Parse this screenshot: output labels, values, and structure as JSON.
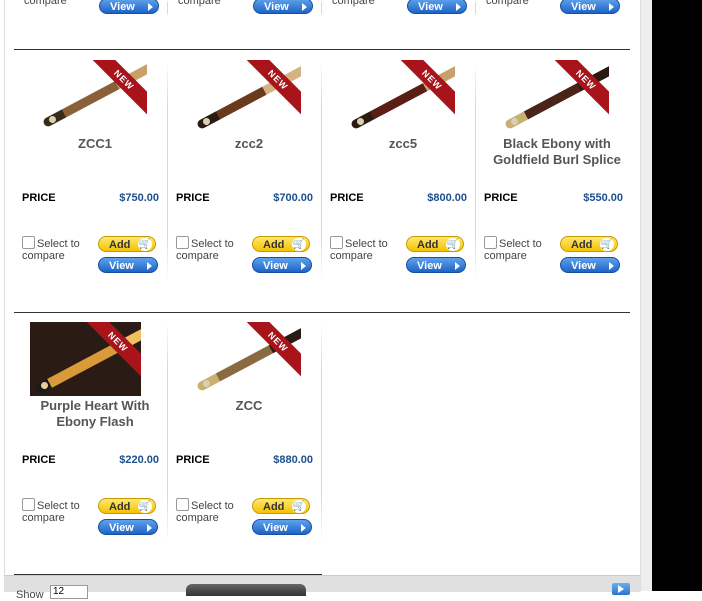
{
  "top_row": {
    "select_fragment": "compare",
    "view_label": "View"
  },
  "rows": [
    {
      "products": [
        {
          "name": "ZCC1",
          "price_label": "PRICE",
          "price": "$750.00",
          "badge": "NEW",
          "compare_label": "Select to compare",
          "add_label": "Add",
          "view_label": "View"
        },
        {
          "name": "zcc2",
          "price_label": "PRICE",
          "price": "$700.00",
          "badge": "NEW",
          "compare_label": "Select to compare",
          "add_label": "Add",
          "view_label": "View"
        },
        {
          "name": "zcc5",
          "price_label": "PRICE",
          "price": "$800.00",
          "badge": "NEW",
          "compare_label": "Select to compare",
          "add_label": "Add",
          "view_label": "View"
        },
        {
          "name": "Black Ebony with Goldfield Burl Splice",
          "price_label": "PRICE",
          "price": "$550.00",
          "badge": "NEW",
          "compare_label": "Select to compare",
          "add_label": "Add",
          "view_label": "View"
        }
      ]
    },
    {
      "products": [
        {
          "name": "Purple Heart With Ebony Flash",
          "price_label": "PRICE",
          "price": "$220.00",
          "badge": "NEW",
          "compare_label": "Select to compare",
          "add_label": "Add",
          "view_label": "View"
        },
        {
          "name": "ZCC",
          "price_label": "PRICE",
          "price": "$880.00",
          "badge": "NEW",
          "compare_label": "Select to compare",
          "add_label": "Add",
          "view_label": "View"
        }
      ]
    }
  ],
  "footer": {
    "show_label": "Show",
    "show_value": "12"
  },
  "colors": {
    "ribbon": "#a8141a",
    "price": "#1e4f8f",
    "add_button": "#f4c200",
    "view_button": "#1d64c8"
  }
}
